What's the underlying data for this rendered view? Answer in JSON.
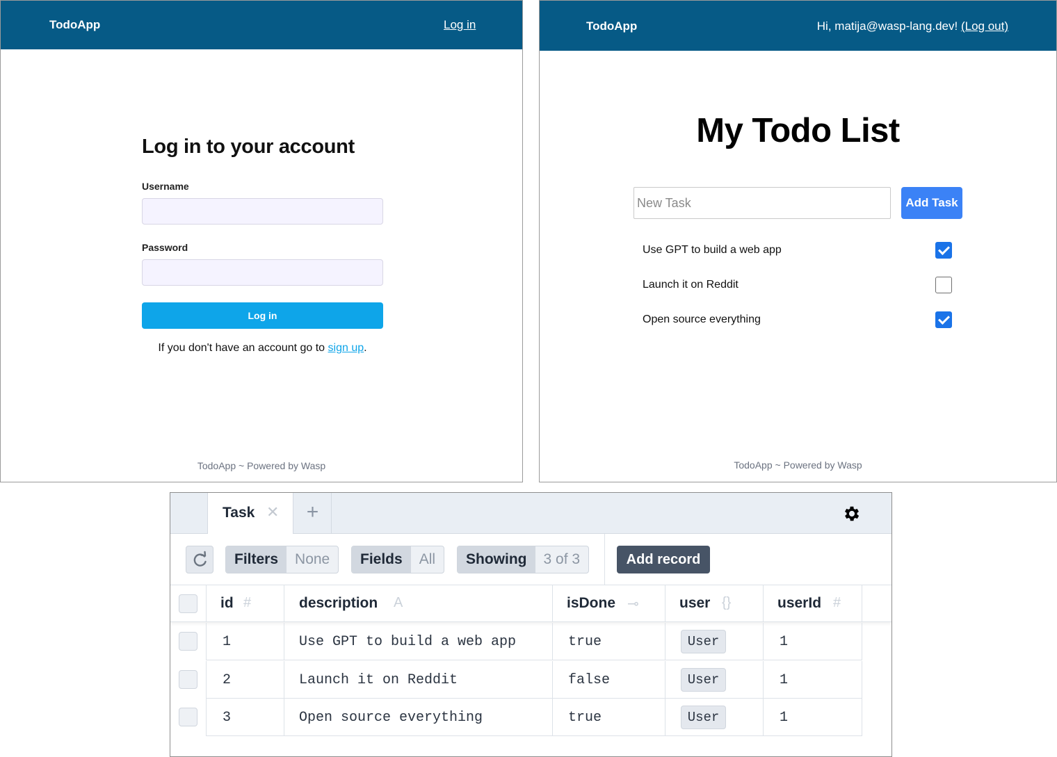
{
  "login_screen": {
    "brand": "TodoApp",
    "nav_login": "Log in",
    "title": "Log in to your account",
    "username_label": "Username",
    "password_label": "Password",
    "submit_label": "Log in",
    "signup_prefix": "If you don't have an account go to ",
    "signup_link": "sign up",
    "signup_suffix": ".",
    "footer": "TodoApp ~ Powered by Wasp"
  },
  "todo_screen": {
    "brand": "TodoApp",
    "greeting": "Hi, matija@wasp-lang.dev! ",
    "logout": "(Log out)",
    "title": "My Todo List",
    "new_task_placeholder": "New Task",
    "add_task_label": "Add Task",
    "tasks": [
      {
        "text": "Use GPT to build a web app",
        "done": true
      },
      {
        "text": "Launch it on Reddit",
        "done": false
      },
      {
        "text": "Open source everything",
        "done": true
      }
    ],
    "footer": "TodoApp ~ Powered by Wasp"
  },
  "db_browser": {
    "tab": "Task",
    "close_glyph": "✕",
    "add_tab_glyph": "+",
    "filters_label": "Filters",
    "filters_value": "None",
    "fields_label": "Fields",
    "fields_value": "All",
    "showing_label": "Showing",
    "showing_value": "3 of 3",
    "add_record": "Add record",
    "columns": [
      {
        "name": "id",
        "type_glyph": "#"
      },
      {
        "name": "description",
        "type_glyph": "A"
      },
      {
        "name": "isDone",
        "type_glyph": "⊸"
      },
      {
        "name": "user",
        "type_glyph": "{}"
      },
      {
        "name": "userId",
        "type_glyph": "#"
      }
    ],
    "rows": [
      {
        "id": "1",
        "description": "Use GPT to build a web app",
        "isDone": "true",
        "user": "User",
        "userId": "1"
      },
      {
        "id": "2",
        "description": "Launch it on Reddit",
        "isDone": "false",
        "user": "User",
        "userId": "1"
      },
      {
        "id": "3",
        "description": "Open source everything",
        "isDone": "true",
        "user": "User",
        "userId": "1"
      }
    ]
  },
  "colors": {
    "navbar": "#065a86",
    "login_button": "#0ea5e9",
    "add_task_button": "#3b82f6",
    "checkbox_checked": "#1a73e8",
    "add_record_button": "#475466"
  },
  "icons": {
    "close_tab": "close-icon",
    "add_tab": "plus-icon",
    "settings": "gear-icon",
    "reload": "refresh-icon"
  }
}
